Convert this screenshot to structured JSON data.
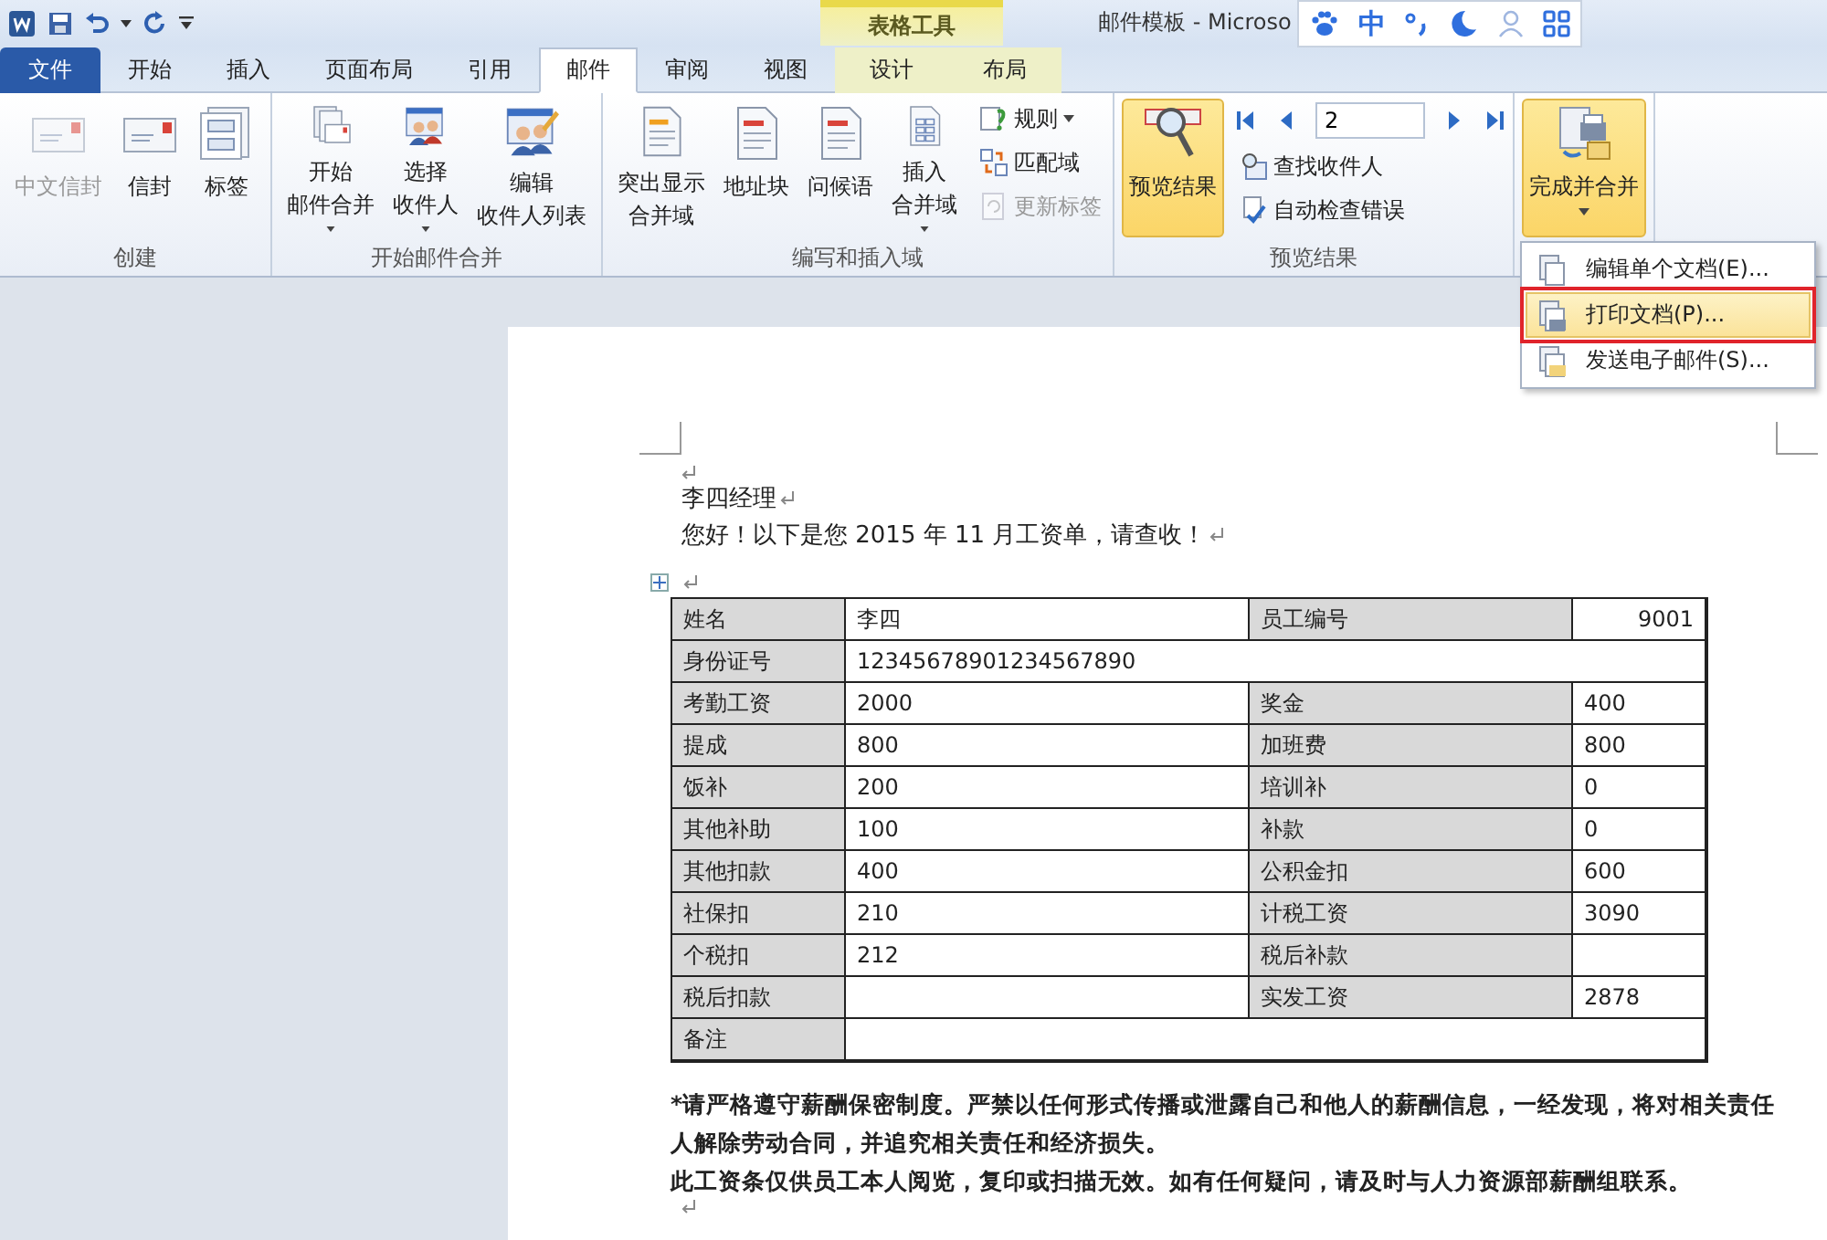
{
  "title_bar": {
    "contextual_group": "表格工具",
    "title": "邮件模板 - Microso"
  },
  "ime_toolbar": {
    "mode": "中"
  },
  "tabs": [
    {
      "label": "文件",
      "kind": "file",
      "selected": false
    },
    {
      "label": "开始",
      "kind": "normal",
      "selected": false
    },
    {
      "label": "插入",
      "kind": "normal",
      "selected": false
    },
    {
      "label": "页面布局",
      "kind": "normal",
      "selected": false
    },
    {
      "label": "引用",
      "kind": "normal",
      "selected": false
    },
    {
      "label": "邮件",
      "kind": "normal",
      "selected": true
    },
    {
      "label": "审阅",
      "kind": "normal",
      "selected": false
    },
    {
      "label": "视图",
      "kind": "normal",
      "selected": false
    },
    {
      "label": "设计",
      "kind": "contextual",
      "selected": false
    },
    {
      "label": "布局",
      "kind": "contextual",
      "selected": false
    }
  ],
  "ribbon": {
    "groups": [
      {
        "label": "创建",
        "buttons": [
          {
            "lines": [
              "中文信封"
            ],
            "disabled": true,
            "dropdown": false,
            "active": false
          },
          {
            "lines": [
              "信封"
            ],
            "disabled": false,
            "dropdown": false,
            "active": false
          },
          {
            "lines": [
              "标签"
            ],
            "disabled": false,
            "dropdown": false,
            "active": false
          }
        ]
      },
      {
        "label": "开始邮件合并",
        "buttons": [
          {
            "lines": [
              "开始",
              "邮件合并"
            ],
            "disabled": false,
            "dropdown": true,
            "active": false
          },
          {
            "lines": [
              "选择",
              "收件人"
            ],
            "disabled": false,
            "dropdown": true,
            "active": false
          },
          {
            "lines": [
              "编辑",
              "收件人列表"
            ],
            "disabled": false,
            "dropdown": false,
            "active": false
          }
        ]
      },
      {
        "label": "编写和插入域",
        "buttons": [
          {
            "lines": [
              "突出显示",
              "合并域"
            ],
            "disabled": false,
            "dropdown": false,
            "active": false
          },
          {
            "lines": [
              "地址块"
            ],
            "disabled": false,
            "dropdown": false,
            "active": false
          },
          {
            "lines": [
              "问候语"
            ],
            "disabled": false,
            "dropdown": false,
            "active": false
          },
          {
            "lines": [
              "插入",
              "合并域"
            ],
            "disabled": false,
            "dropdown": true,
            "active": false
          }
        ],
        "small_buttons": [
          {
            "label": "规则",
            "disabled": false,
            "dropdown": true
          },
          {
            "label": "匹配域",
            "disabled": false,
            "dropdown": false
          },
          {
            "label": "更新标签",
            "disabled": true,
            "dropdown": false
          }
        ]
      },
      {
        "label": "预览结果",
        "buttons": [
          {
            "lines": [
              "预览结果"
            ],
            "disabled": false,
            "dropdown": false,
            "active": true
          }
        ],
        "record_field": {
          "value": "2"
        },
        "small_buttons": [
          {
            "label": "查找收件人",
            "disabled": false
          },
          {
            "label": "自动检查错误",
            "disabled": false
          }
        ]
      },
      {
        "buttons": [
          {
            "lines": [
              "完成并合并"
            ],
            "disabled": false,
            "dropdown": true,
            "active": true
          }
        ]
      }
    ]
  },
  "merge_menu": {
    "items": [
      {
        "label": "编辑单个文档(E)...",
        "selected": false,
        "boxed": false
      },
      {
        "label": "打印文档(P)...",
        "selected": true,
        "boxed": true
      },
      {
        "label": "发送电子邮件(S)...",
        "selected": false,
        "boxed": false
      }
    ]
  },
  "document": {
    "salutation": "李四经理",
    "greeting": "您好！以下是您 2015 年 11 月工资单，请查收！",
    "table": {
      "rows": [
        {
          "label": "姓名",
          "value": "李四",
          "label2": "员工编号",
          "value2": "9001"
        },
        {
          "label": "身份证号",
          "value": "12345678901234567890"
        },
        {
          "label": "考勤工资",
          "value": "2000",
          "label2": "奖金",
          "value2": "400"
        },
        {
          "label": "提成",
          "value": "800",
          "label2": "加班费",
          "value2": "800"
        },
        {
          "label": "饭补",
          "value": "200",
          "label2": "培训补",
          "value2": "0"
        },
        {
          "label": "其他补助",
          "value": "100",
          "label2": "补款",
          "value2": "0"
        },
        {
          "label": "其他扣款",
          "value": "400",
          "label2": "公积金扣",
          "value2": "600"
        },
        {
          "label": "社保扣",
          "value": "210",
          "label2": "计税工资",
          "value2": "3090"
        },
        {
          "label": "个税扣",
          "value": "212",
          "label2": "税后补款"
        },
        {
          "label": "税后扣款",
          "label2": "实发工资",
          "value2": "2878"
        },
        {
          "label": "备注"
        }
      ]
    },
    "notes": [
      "*请严格遵守薪酬保密制度。严禁以任何形式传播或泄露自己和他人的薪酬信息，一经发现，将对相关责任人解除劳动合同，并追究相关责任和经济损失。",
      "此工资条仅供员工本人阅览，复印或扫描无效。如有任何疑问，请及时与人力资源部薪酬组联系。"
    ]
  }
}
